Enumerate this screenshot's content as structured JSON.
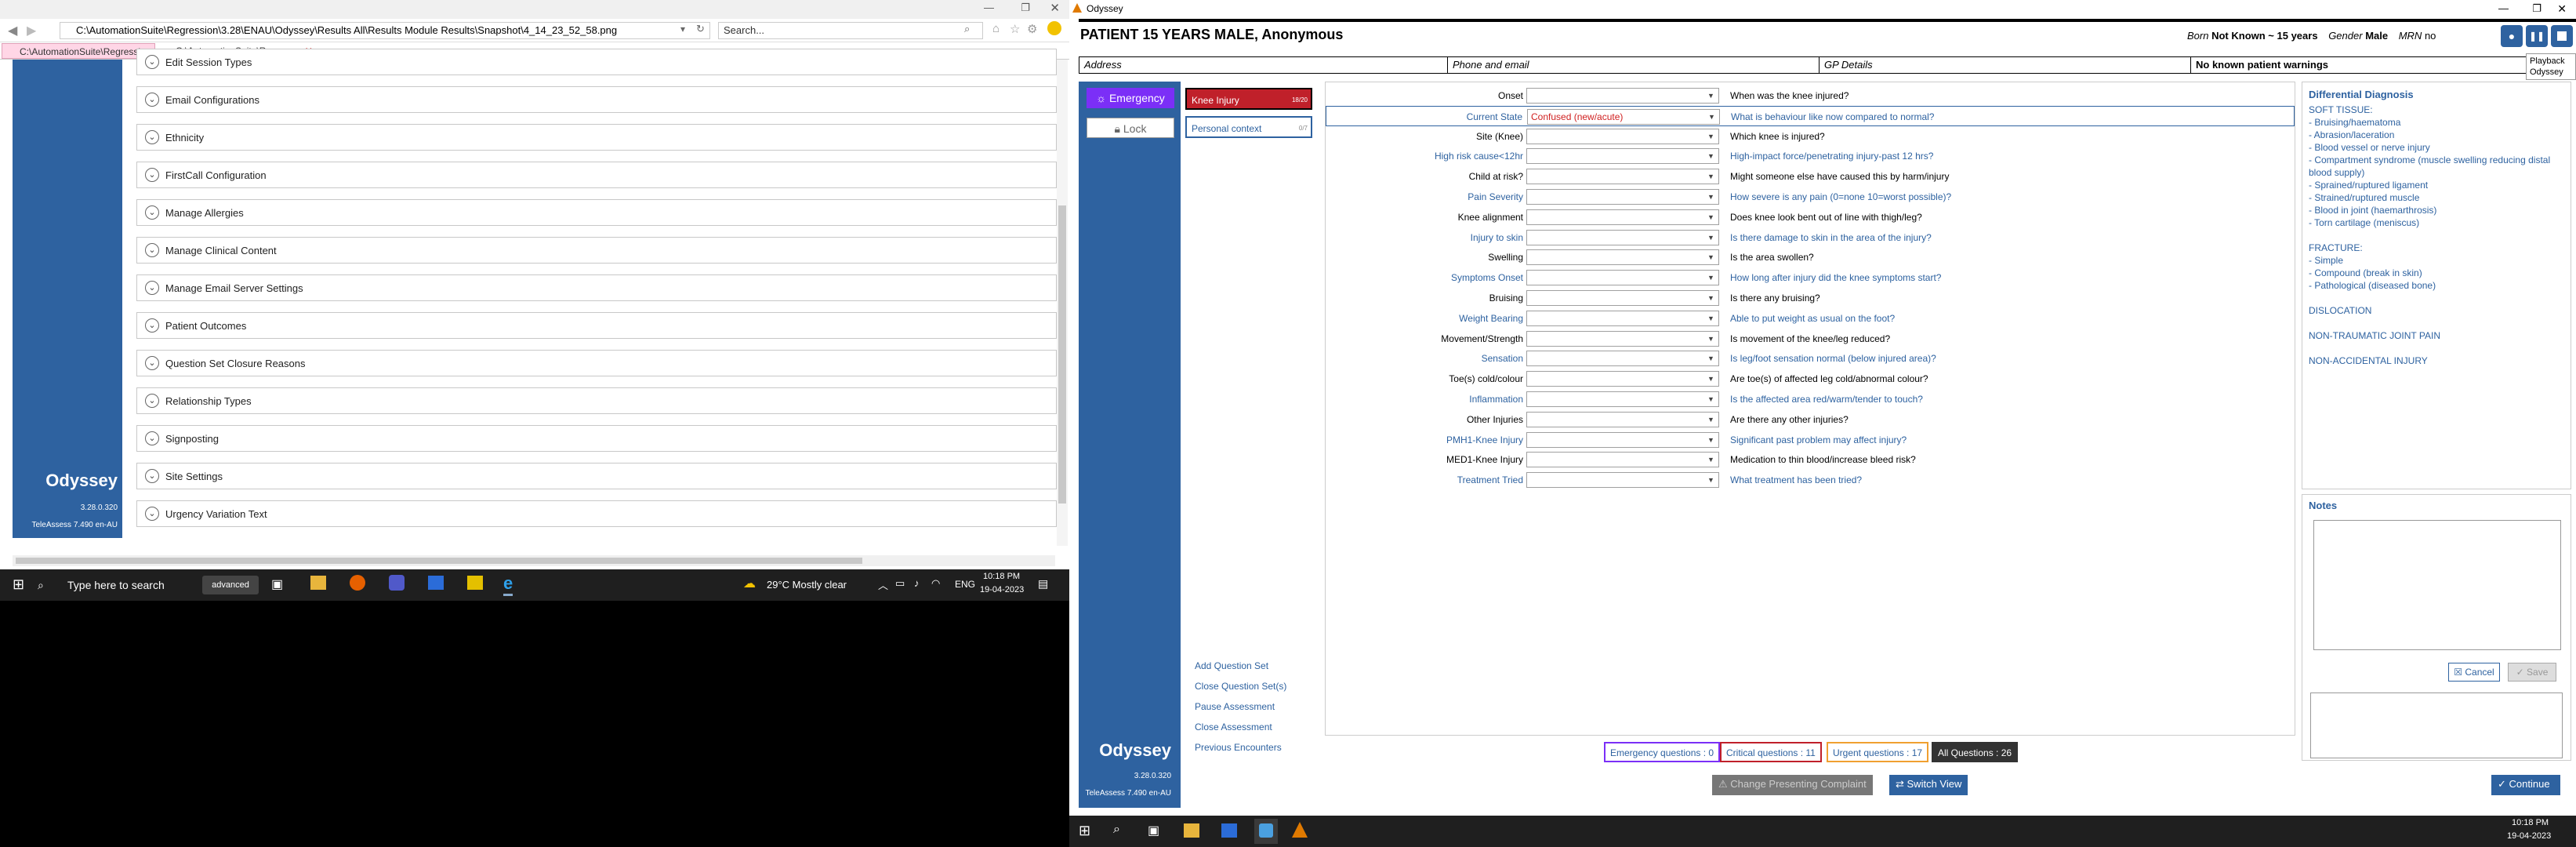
{
  "left_window": {
    "address": "C:\\AutomationSuite\\Regression\\3.28\\ENAU\\Odyssey\\Results All\\Results Module Results\\Snapshot\\4_14_23_52_58.png",
    "search_placeholder": "Search...",
    "tabs": [
      {
        "label": "C:\\AutomationSuite\\Regressio..."
      },
      {
        "label": "C:\\AutomationSuite\\Regres..."
      }
    ],
    "brand": {
      "name": "Odyssey",
      "version": "3.28.0.320",
      "teleassess": "TeleAssess 7.490 en-AU"
    },
    "accordion": [
      "Edit Session Types",
      "Email Configurations",
      "Ethnicity",
      "FirstCall Configuration",
      "Manage Allergies",
      "Manage Clinical Content",
      "Manage Email Server Settings",
      "Patient Outcomes",
      "Question Set Closure Reasons",
      "Relationship Types",
      "Signposting",
      "Site Settings",
      "Urgency Variation Text"
    ],
    "taskbar": {
      "search": "Type here to search",
      "weather": "29°C  Mostly clear",
      "lang": "ENG",
      "time": "10:18 PM",
      "date": "19-04-2023"
    }
  },
  "right_window": {
    "title": "Odyssey",
    "patient": {
      "heading": "PATIENT 15 YEARS MALE, Anonymous",
      "born_label": "Born",
      "born_value": "Not Known ~ 15 years",
      "gender_label": "Gender",
      "gender_value": "Male",
      "mrn_label": "MRN",
      "mrn_value": "no"
    },
    "playback_tooltip": [
      "Playback",
      "Odyssey"
    ],
    "address_bar": {
      "address": "Address",
      "phone": "Phone and email",
      "gp": "GP Details",
      "warnings": "No known patient warnings"
    },
    "nav": {
      "emergency": "Emergency",
      "lock": "Lock",
      "brand": "Odyssey",
      "version": "3.28.0.320",
      "teleassess": "TeleAssess 7.490 en-AU"
    },
    "question_sets": [
      {
        "label": "Knee Injury",
        "count": "18/20"
      },
      {
        "label": "Personal context",
        "count": "0/7"
      }
    ],
    "side_links": [
      "Add Question Set",
      "Close Question Set(s)",
      "Pause Assessment",
      "Close Assessment",
      "Previous Encounters"
    ],
    "questions": [
      {
        "label": "Onset",
        "value": "",
        "question": "When was the knee injured?",
        "style": "normal"
      },
      {
        "label": "Current State",
        "value": "Confused (new/acute)",
        "question": "What is behaviour like now compared to normal?",
        "style": "blue"
      },
      {
        "label": "Site (Knee)",
        "value": "",
        "question": "Which knee is injured?",
        "style": "normal"
      },
      {
        "label": "High risk cause<12hr",
        "value": "",
        "question": "High-impact force/penetrating injury-past 12 hrs?",
        "style": "blue"
      },
      {
        "label": "Child at risk?",
        "value": "",
        "question": "Might someone else have caused this by harm/injury",
        "style": "normal"
      },
      {
        "label": "Pain Severity",
        "value": "",
        "question": "How severe is any pain (0=none 10=worst possible)?",
        "style": "blue"
      },
      {
        "label": "Knee alignment",
        "value": "",
        "question": "Does knee look bent out of line with thigh/leg?",
        "style": "normal"
      },
      {
        "label": "Injury to skin",
        "value": "",
        "question": "Is there damage to skin in the area of the injury?",
        "style": "blue"
      },
      {
        "label": "Swelling",
        "value": "",
        "question": "Is the area swollen?",
        "style": "normal"
      },
      {
        "label": "Symptoms Onset",
        "value": "",
        "question": "How long after injury did the knee symptoms start?",
        "style": "blue"
      },
      {
        "label": "Bruising",
        "value": "",
        "question": "Is there any bruising?",
        "style": "normal"
      },
      {
        "label": "Weight Bearing",
        "value": "",
        "question": "Able to put weight as usual on the foot?",
        "style": "blue"
      },
      {
        "label": "Movement/Strength",
        "value": "",
        "question": "Is movement of the knee/leg reduced?",
        "style": "normal"
      },
      {
        "label": "Sensation",
        "value": "",
        "question": "Is leg/foot sensation normal (below injured area)?",
        "style": "blue"
      },
      {
        "label": "Toe(s) cold/colour",
        "value": "",
        "question": "Are toe(s) of affected leg cold/abnormal colour?",
        "style": "normal"
      },
      {
        "label": "Inflammation",
        "value": "",
        "question": "Is the affected area red/warm/tender to touch?",
        "style": "blue"
      },
      {
        "label": "Other Injuries",
        "value": "",
        "question": "Are there any other injuries?",
        "style": "normal"
      },
      {
        "label": "PMH1-Knee Injury",
        "value": "",
        "question": "Significant past problem may affect injury?",
        "style": "blue"
      },
      {
        "label": "MED1-Knee Injury",
        "value": "",
        "question": "Medication to thin blood/increase bleed risk?",
        "style": "normal"
      },
      {
        "label": "Treatment Tried",
        "value": "",
        "question": "What treatment has been tried?",
        "style": "blue"
      }
    ],
    "differential": {
      "title": "Differential Diagnosis",
      "lines": [
        "SOFT TISSUE:",
        "- Bruising/haematoma",
        "- Abrasion/laceration",
        "- Blood vessel or nerve injury",
        "- Compartment syndrome (muscle swelling reducing distal blood supply)",
        "- Sprained/ruptured ligament",
        "- Strained/ruptured muscle",
        "- Blood in joint (haemarthrosis)",
        "- Torn cartilage (meniscus)",
        "",
        "FRACTURE:",
        "- Simple",
        "- Compound (break in skin)",
        "- Pathological (diseased bone)",
        "",
        "DISLOCATION",
        "",
        "NON-TRAUMATIC JOINT PAIN",
        "",
        "NON-ACCIDENTAL INJURY"
      ]
    },
    "notes": {
      "title": "Notes",
      "cancel": "Cancel",
      "save": "Save"
    },
    "badges": {
      "emergency": "Emergency questions : 0",
      "critical": "Critical questions : 11",
      "urgent": "Urgent questions : 17",
      "all": "All Questions : 26"
    },
    "buttons": {
      "change_complaint": "Change Presenting Complaint",
      "switch_view": "Switch View",
      "continue": "Continue"
    },
    "taskbar": {
      "time": "10:18 PM",
      "date": "19-04-2023"
    },
    "colors": {
      "nav_blue": "#2e62a0",
      "emergency": "#7b2ff7",
      "knee_tab": "#c0202a"
    }
  }
}
